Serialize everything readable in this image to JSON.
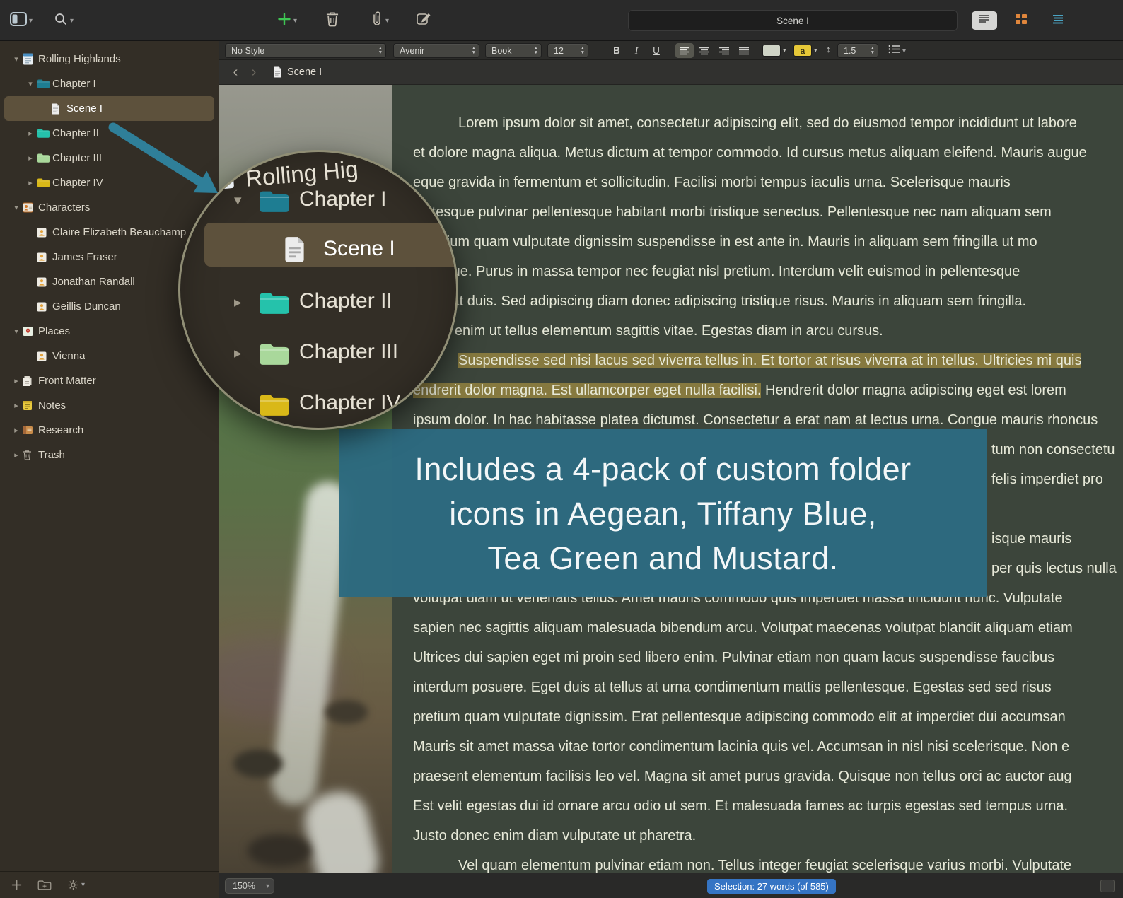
{
  "toolbar": {
    "title_value": "Scene I",
    "icons": [
      "panel-toggle",
      "search",
      "add",
      "trash",
      "link",
      "compose"
    ],
    "view_modes": [
      "document",
      "corkboard",
      "outline"
    ]
  },
  "format_bar": {
    "style": "No Style",
    "font": "Avenir",
    "typeface": "Book",
    "size": "12",
    "bold": "B",
    "italic": "I",
    "underline": "U",
    "highlight_letter": "a",
    "line_spacing": "1.5"
  },
  "header": {
    "doc_title": "Scene I"
  },
  "sidebar": {
    "items": [
      {
        "label": "Rolling Highlands",
        "depth": 0,
        "icon": "manuscript",
        "disclosure": "open"
      },
      {
        "label": "Chapter I",
        "depth": 1,
        "icon": "folder",
        "color": "#1e7d92",
        "disclosure": "open"
      },
      {
        "label": "Scene I",
        "depth": 2,
        "icon": "doc",
        "selected": true
      },
      {
        "label": "Chapter II",
        "depth": 1,
        "icon": "folder",
        "color": "#25c2ab",
        "disclosure": "closed"
      },
      {
        "label": "Chapter III",
        "depth": 1,
        "icon": "folder",
        "color": "#a9d89b",
        "disclosure": "closed"
      },
      {
        "label": "Chapter IV",
        "depth": 1,
        "icon": "folder",
        "color": "#d9b818",
        "disclosure": "closed"
      },
      {
        "label": "Characters",
        "depth": 0,
        "icon": "characters",
        "disclosure": "open"
      },
      {
        "label": "Claire Elizabeth Beauchamp",
        "depth": 1,
        "icon": "card"
      },
      {
        "label": "James Fraser",
        "depth": 1,
        "icon": "card"
      },
      {
        "label": "Jonathan Randall",
        "depth": 1,
        "icon": "card"
      },
      {
        "label": "Geillis Duncan",
        "depth": 1,
        "icon": "card"
      },
      {
        "label": "Places",
        "depth": 0,
        "icon": "places",
        "disclosure": "open"
      },
      {
        "label": "Vienna",
        "depth": 1,
        "icon": "card"
      },
      {
        "label": "Front Matter",
        "depth": 0,
        "icon": "frontmatter",
        "disclosure": "closed"
      },
      {
        "label": "Notes",
        "depth": 0,
        "icon": "notes",
        "disclosure": "closed"
      },
      {
        "label": "Research",
        "depth": 0,
        "icon": "research",
        "disclosure": "closed"
      },
      {
        "label": "Trash",
        "depth": 0,
        "icon": "trash",
        "disclosure": "closed"
      }
    ]
  },
  "magnifier": {
    "partial_label": "Rolling Hig",
    "items": [
      {
        "label": "Chapter I",
        "icon": "folder",
        "color": "#1e7d92",
        "disclosure": "open"
      },
      {
        "label": "Scene I",
        "icon": "doc",
        "selected": true
      },
      {
        "label": "Chapter II",
        "icon": "folder",
        "color": "#25c2ab",
        "disclosure": "closed"
      },
      {
        "label": "Chapter III",
        "icon": "folder",
        "color": "#a9d89b",
        "disclosure": "closed"
      },
      {
        "label": "Chapter IV",
        "icon": "folder",
        "color": "#d9b818",
        "disclosure": "closed"
      }
    ]
  },
  "callout": {
    "lines": [
      "Includes a 4-pack of custom folder",
      "icons in Aegean, Tiffany Blue,",
      "Tea Green and Mustard."
    ],
    "background": "#2c6a80"
  },
  "colors": {
    "aegean": "#1e7d92",
    "tiffany_blue": "#25c2ab",
    "tea_green": "#a9d89b",
    "mustard": "#d9b818",
    "selection_highlight": "#86793f",
    "editor_background": "#3c453b",
    "sidebar_background": "#332e26"
  },
  "editor": {
    "lines": [
      {
        "indent": true,
        "seg": [
          {
            "t": "Lorem ipsum dolor sit amet, consectetur adipiscing elit, sed do eiusmod tempor incididunt ut labore",
            "h": false
          }
        ]
      },
      {
        "seg": [
          {
            "t": "et dolore magna aliqua. Metus dictum at tempor commodo. Id cursus metus aliquam eleifend. Mauris augue",
            "h": false
          }
        ]
      },
      {
        "seg": [
          {
            "t": "eque gravida in fermentum et sollicitudin. Facilisi morbi tempus iaculis urna. Scelerisque mauris",
            "h": false
          }
        ]
      },
      {
        "seg": [
          {
            "t": "lentesque pulvinar pellentesque habitant morbi tristique senectus. Pellentesque nec nam aliquam sem",
            "h": false
          }
        ]
      },
      {
        "seg": [
          {
            "t": ". Pretium quam vulputate dignissim suspendisse in est ante in. Mauris in aliquam sem fringilla ut mo",
            "h": false
          }
        ]
      },
      {
        "seg": [
          {
            "t": "nt augue. Purus in massa tempor nec feugiat nisl pretium. Interdum velit euismod in pellentesque",
            "h": false
          }
        ]
      },
      {
        "seg": [
          {
            "t": "placerat duis. Sed adipiscing diam donec adipiscing tristique risus. Mauris in aliquam sem fringilla.",
            "h": false
          }
        ]
      },
      {
        "seg": [
          {
            "t": "mattis enim ut tellus elementum sagittis vitae. Egestas diam in arcu cursus.",
            "h": false
          }
        ]
      },
      {
        "indent": true,
        "seg": [
          {
            "t": "Suspendisse sed nisi lacus sed viverra tellus in. Et tortor at risus viverra at in tellus. Ultricies mi quis",
            "h": true
          }
        ]
      },
      {
        "seg": [
          {
            "t": "endrerit dolor magna. Est ullamcorper eget nulla facilisi.",
            "h": true
          },
          {
            "t": " Hendrerit dolor magna adipiscing eget est lorem",
            "h": false
          }
        ]
      },
      {
        "seg": [
          {
            "t": "ipsum dolor. In hac habitasse platea dictumst. Consectetur a erat nam at lectus urna. Congue mauris rhoncus",
            "h": false
          }
        ]
      },
      {
        "frag": true,
        "seg": [
          {
            "t": "tum non consectetu",
            "h": false
          }
        ]
      },
      {
        "frag": true,
        "seg": [
          {
            "t": "felis imperdiet pro",
            "h": false
          }
        ]
      },
      {
        "frag": true,
        "seg": [
          {
            "t": "",
            "h": false
          }
        ]
      },
      {
        "frag": true,
        "seg": [
          {
            "t": "isque mauris",
            "h": false
          }
        ]
      },
      {
        "frag": true,
        "seg": [
          {
            "t": "per quis lectus nulla",
            "h": false
          }
        ]
      },
      {
        "seg": [
          {
            "t": "volutpat diam ut venenatis tellus. Amet mauris commodo quis imperdiet massa tincidunt nunc. Vulputate",
            "h": false
          }
        ]
      },
      {
        "seg": [
          {
            "t": "sapien nec sagittis aliquam malesuada bibendum arcu. Volutpat maecenas volutpat blandit aliquam etiam",
            "h": false
          }
        ]
      },
      {
        "seg": [
          {
            "t": "Ultrices dui sapien eget mi proin sed libero enim. Pulvinar etiam non quam lacus suspendisse faucibus",
            "h": false
          }
        ]
      },
      {
        "seg": [
          {
            "t": "interdum posuere. Eget duis at tellus at urna condimentum mattis pellentesque. Egestas sed sed risus",
            "h": false
          }
        ]
      },
      {
        "seg": [
          {
            "t": "pretium quam vulputate dignissim. Erat pellentesque adipiscing commodo elit at imperdiet dui accumsan",
            "h": false
          }
        ]
      },
      {
        "seg": [
          {
            "t": "Mauris sit amet massa vitae tortor condimentum lacinia quis vel. Accumsan in nisl nisi scelerisque. Non e",
            "h": false
          }
        ]
      },
      {
        "seg": [
          {
            "t": "praesent elementum facilisis leo vel. Magna sit amet purus gravida. Quisque non tellus orci ac auctor aug",
            "h": false
          }
        ]
      },
      {
        "seg": [
          {
            "t": "Est velit egestas dui id ornare arcu odio ut sem. Et malesuada fames ac turpis egestas sed tempus urna.",
            "h": false
          }
        ]
      },
      {
        "seg": [
          {
            "t": "Justo donec enim diam vulputate ut pharetra.",
            "h": false
          }
        ]
      },
      {
        "indent": true,
        "seg": [
          {
            "t": "Vel quam elementum pulvinar etiam non. Tellus integer feugiat scelerisque varius morbi. Vulputate",
            "h": false
          }
        ]
      }
    ]
  },
  "status_bar": {
    "zoom": "150%",
    "selection": "Selection: 27 words (of 585)"
  }
}
